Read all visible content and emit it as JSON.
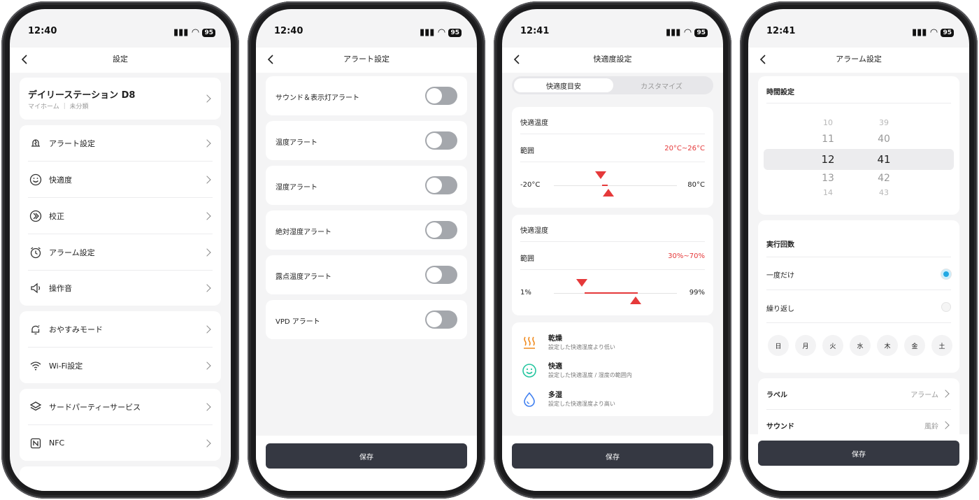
{
  "status": {
    "time1": "12:40",
    "time2": "12:40",
    "time3": "12:41",
    "time4": "12:41",
    "battery": "95"
  },
  "s1": {
    "title": "設定",
    "device": {
      "name": "デイリーステーション D8",
      "location": "マイホーム",
      "category": "未分類"
    },
    "items": [
      {
        "label": "アラート設定",
        "icon": "alert-bell-icon"
      },
      {
        "label": "快適度",
        "icon": "smiley-icon"
      },
      {
        "label": "校正",
        "icon": "calibrate-icon"
      },
      {
        "label": "アラーム設定",
        "icon": "alarm-clock-icon"
      },
      {
        "label": "操作音",
        "icon": "speaker-icon"
      },
      {
        "label": "おやすみモード",
        "icon": "sleep-bell-icon"
      },
      {
        "label": "Wi-Fi設定",
        "icon": "wifi-icon"
      },
      {
        "label": "サードパーティーサービス",
        "icon": "layers-icon"
      },
      {
        "label": "NFC",
        "icon": "nfc-icon"
      }
    ]
  },
  "s2": {
    "title": "アラート設定",
    "toggles": [
      {
        "label": "サウンド＆表示灯アラート",
        "on": false
      },
      {
        "label": "温度アラート",
        "on": false
      },
      {
        "label": "湿度アラート",
        "on": false
      },
      {
        "label": "絶対湿度アラート",
        "on": false
      },
      {
        "label": "露点温度アラート",
        "on": false
      },
      {
        "label": "VPD アラート",
        "on": false
      }
    ],
    "save": "保存"
  },
  "s3": {
    "title": "快適度設定",
    "tabs": [
      "快適度目安",
      "カスタマイズ"
    ],
    "temp": {
      "heading": "快適温度",
      "range_label": "範囲",
      "range": "20°C~26°C",
      "min": "-20°C",
      "max": "80°C",
      "low": 20,
      "high": 26
    },
    "hum": {
      "heading": "快適湿度",
      "range_label": "範囲",
      "range": "30%~70%",
      "min": "1%",
      "max": "99%",
      "low": 30,
      "high": 70
    },
    "legend": [
      {
        "title": "乾燥",
        "desc": "設定した快適湿度より低い",
        "icon": "heat-icon",
        "color": "#f08a1d"
      },
      {
        "title": "快適",
        "desc": "設定した快適温度 / 湿度の範囲内",
        "icon": "smile-face-icon",
        "color": "#26c6a0"
      },
      {
        "title": "多湿",
        "desc": "設定した快適湿度より高い",
        "icon": "water-drop-icon",
        "color": "#3f7ff0"
      }
    ],
    "save": "保存"
  },
  "s4": {
    "title": "アラーム設定",
    "time_heading": "時間設定",
    "hours": [
      "10",
      "11",
      "12",
      "13",
      "14"
    ],
    "minutes": [
      "39",
      "40",
      "41",
      "42",
      "43"
    ],
    "repeat_heading": "実行回数",
    "once": "一度だけ",
    "repeat": "繰り返し",
    "selected": "一度だけ",
    "days": [
      "日",
      "月",
      "火",
      "水",
      "木",
      "金",
      "土"
    ],
    "label_key": "ラベル",
    "label_val": "アラーム",
    "sound_key": "サウンド",
    "sound_val": "風鈴",
    "save": "保存"
  }
}
